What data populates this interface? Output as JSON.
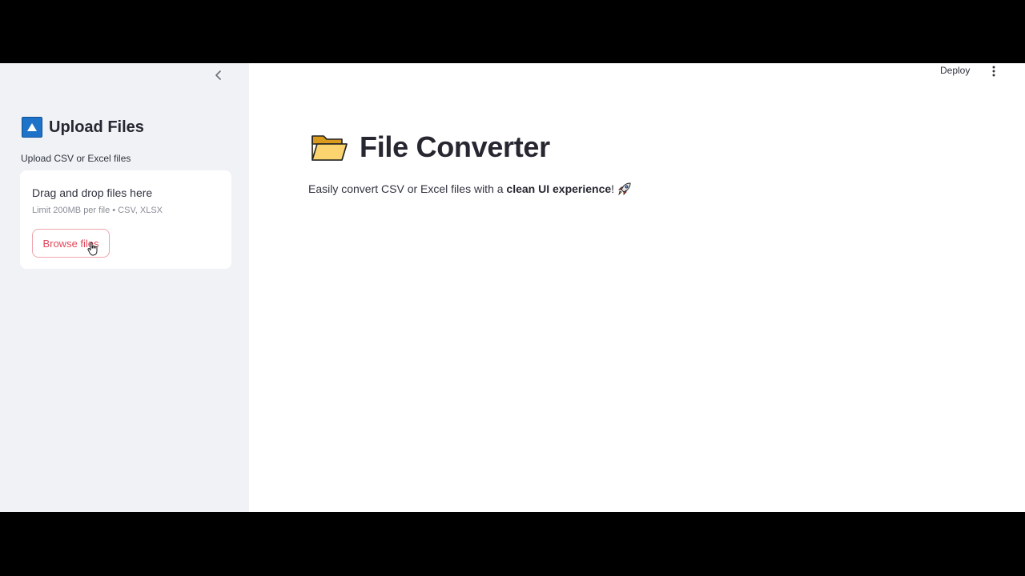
{
  "sidebar": {
    "title": "Upload Files",
    "upload_label": "Upload CSV or Excel files",
    "dropzone": {
      "title": "Drag and drop files here",
      "limit": "Limit 200MB per file • CSV, XLSX",
      "browse_label": "Browse files"
    },
    "icons": {
      "collapse": "chevron-left-icon",
      "upload": "up-arrow-box-icon"
    }
  },
  "header": {
    "deploy_label": "Deploy",
    "menu_icon": "kebab-menu-icon"
  },
  "main": {
    "title": "File Converter",
    "title_icon": "open-folder-icon",
    "subtitle_prefix": "Easily convert CSV or Excel files with a ",
    "subtitle_bold": "clean UI experience",
    "subtitle_suffix": "!",
    "subtitle_icon": "rocket-icon"
  },
  "colors": {
    "sidebar_bg": "#f0f2f6",
    "accent": "#e0485a",
    "upload_icon_blue": "#1e73c8",
    "text": "#31333f"
  }
}
